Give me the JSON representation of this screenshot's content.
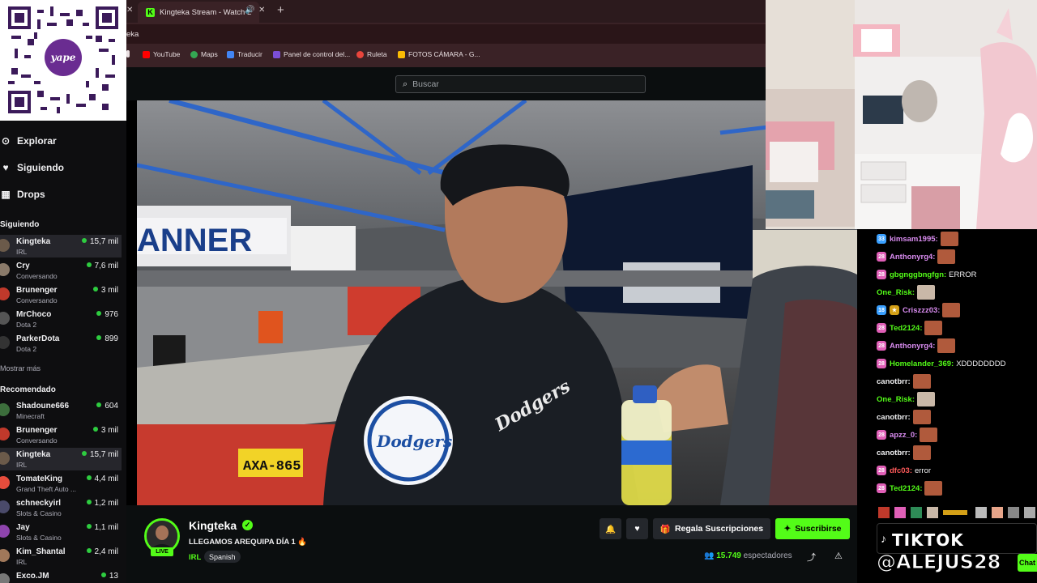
{
  "qr": {
    "brand": "yape"
  },
  "sidebar": {
    "nav": [
      {
        "label": "Explorar",
        "icon": "compass-icon"
      },
      {
        "label": "Siguiendo",
        "icon": "heart-icon"
      },
      {
        "label": "Drops",
        "icon": "gift-icon"
      }
    ],
    "following_title": "Siguiendo",
    "following": [
      {
        "name": "Kingteka",
        "game": "IRL",
        "viewers": "15,7 mil"
      },
      {
        "name": "Cry",
        "game": "Conversando",
        "viewers": "7,6 mil"
      },
      {
        "name": "Brunenger",
        "game": "Conversando",
        "viewers": "3 mil"
      },
      {
        "name": "MrChoco",
        "game": "Dota 2",
        "viewers": "976"
      },
      {
        "name": "ParkerDota",
        "game": "Dota 2",
        "viewers": "899"
      }
    ],
    "show_more": "Mostrar más",
    "recommended_title": "Recomendado",
    "recommended": [
      {
        "name": "Shadoune666",
        "game": "Minecraft",
        "viewers": "604"
      },
      {
        "name": "Brunenger",
        "game": "Conversando",
        "viewers": "3 mil"
      },
      {
        "name": "Kingteka",
        "game": "IRL",
        "viewers": "15,7 mil"
      },
      {
        "name": "TomateKing",
        "game": "Grand Theft Auto ...",
        "viewers": "4,4 mil"
      },
      {
        "name": "schneckyirl",
        "game": "Slots & Casino",
        "viewers": "1,2 mil"
      },
      {
        "name": "Jay",
        "game": "Slots & Casino",
        "viewers": "1,1 mil"
      },
      {
        "name": "Kim_Shantal",
        "game": "IRL",
        "viewers": "2,4 mil"
      },
      {
        "name": "Exco.JM",
        "game": "",
        "viewers": "13"
      }
    ]
  },
  "browser": {
    "tab_title": "Kingteka Stream - Watch L",
    "url_fragment": "eka",
    "bookmarks": [
      {
        "label": "YouTube",
        "color": "#ff0000"
      },
      {
        "label": "Maps",
        "color": "#34a853"
      },
      {
        "label": "Traducir",
        "color": "#4285f4"
      },
      {
        "label": "Panel de control del...",
        "color": "#7b4fd6"
      },
      {
        "label": "Ruleta",
        "color": "#e8453c"
      },
      {
        "label": "FOTOS CÁMARA - G...",
        "color": "#fbbc04"
      }
    ]
  },
  "kick": {
    "search_placeholder": "Buscar"
  },
  "video": {
    "plate": "AXA-865",
    "banner": "ANNER"
  },
  "stream": {
    "name": "Kingteka",
    "live": "LIVE",
    "title": "LLEGAMOS AREQUIPA DÍA 1 🔥",
    "category": "IRL",
    "language": "Spanish",
    "gift_subs": "Regala Suscripciones",
    "subscribe": "Suscribirse",
    "viewer_count": "15.749",
    "viewer_label": "espectadores"
  },
  "chat": {
    "messages": [
      {
        "user": "kimsam1995:",
        "color": "#d98cf0",
        "badge": "33",
        "badge_color": "#3aa0ff",
        "emote": true,
        "text": ""
      },
      {
        "user": "Anthonyrg4:",
        "color": "#d98cf0",
        "badge": "28",
        "badge_color": "#e05fb7",
        "emote": true,
        "text": ""
      },
      {
        "user": "gbgnggbngfgn:",
        "color": "#53fc18",
        "badge": "28",
        "badge_color": "#e05fb7",
        "emote": false,
        "text": "ERROR"
      },
      {
        "user": "One_Risk:",
        "color": "#53fc18",
        "badge": "",
        "badge_color": "",
        "emote": true,
        "cat": true,
        "text": ""
      },
      {
        "user": "Criszzz03:",
        "color": "#d98cf0",
        "badge": "18",
        "badge_color": "#3aa0ff",
        "emote": true,
        "text": ""
      },
      {
        "user": "Ted2124:",
        "color": "#53fc18",
        "badge": "28",
        "badge_color": "#e05fb7",
        "emote": true,
        "text": ""
      },
      {
        "user": "Anthonyrg4:",
        "color": "#d98cf0",
        "badge": "28",
        "badge_color": "#e05fb7",
        "emote": true,
        "text": ""
      },
      {
        "user": "Homelander_369:",
        "color": "#53fc18",
        "badge": "28",
        "badge_color": "#e05fb7",
        "emote": false,
        "text": "XDDDDDDDD"
      },
      {
        "user": "canotbrr:",
        "color": "#efeff1",
        "badge": "",
        "badge_color": "",
        "emote": true,
        "text": ""
      },
      {
        "user": "One_Risk:",
        "color": "#53fc18",
        "badge": "",
        "badge_color": "",
        "emote": true,
        "cat": true,
        "text": ""
      },
      {
        "user": "canotbrr:",
        "color": "#efeff1",
        "badge": "",
        "badge_color": "",
        "emote": true,
        "text": ""
      },
      {
        "user": "apzz_0:",
        "color": "#d98cf0",
        "badge": "28",
        "badge_color": "#e05fb7",
        "emote": true,
        "text": ""
      },
      {
        "user": "canotbrr:",
        "color": "#efeff1",
        "badge": "",
        "badge_color": "",
        "emote": true,
        "text": ""
      },
      {
        "user": "dfc03:",
        "color": "#ff5a5a",
        "badge": "28",
        "badge_color": "#e05fb7",
        "emote": false,
        "text": "error"
      },
      {
        "user": "Ted2124:",
        "color": "#53fc18",
        "badge": "28",
        "badge_color": "#e05fb7",
        "emote": true,
        "text": ""
      }
    ],
    "chat_button": "Chat"
  },
  "overlay": {
    "tiktok": "TIKTOK",
    "handle": "@ALEJUS28"
  },
  "colors": {
    "accent": "#53fc18",
    "bg": "#0b0e0f",
    "chrome": "#3a2226"
  }
}
